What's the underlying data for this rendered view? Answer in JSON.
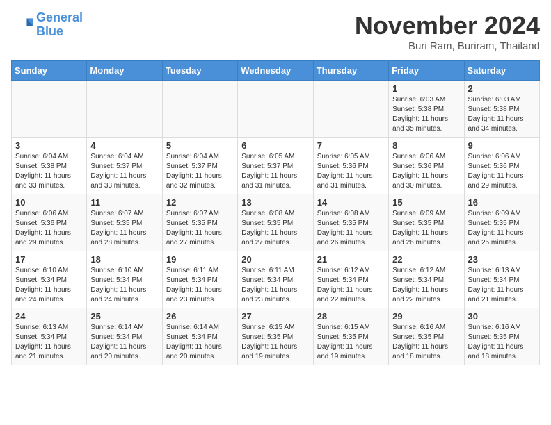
{
  "header": {
    "logo_line1": "General",
    "logo_line2": "Blue",
    "month": "November 2024",
    "location": "Buri Ram, Buriram, Thailand"
  },
  "weekdays": [
    "Sunday",
    "Monday",
    "Tuesday",
    "Wednesday",
    "Thursday",
    "Friday",
    "Saturday"
  ],
  "weeks": [
    [
      {
        "day": "",
        "text": ""
      },
      {
        "day": "",
        "text": ""
      },
      {
        "day": "",
        "text": ""
      },
      {
        "day": "",
        "text": ""
      },
      {
        "day": "",
        "text": ""
      },
      {
        "day": "1",
        "text": "Sunrise: 6:03 AM\nSunset: 5:38 PM\nDaylight: 11 hours\nand 35 minutes."
      },
      {
        "day": "2",
        "text": "Sunrise: 6:03 AM\nSunset: 5:38 PM\nDaylight: 11 hours\nand 34 minutes."
      }
    ],
    [
      {
        "day": "3",
        "text": "Sunrise: 6:04 AM\nSunset: 5:38 PM\nDaylight: 11 hours\nand 33 minutes."
      },
      {
        "day": "4",
        "text": "Sunrise: 6:04 AM\nSunset: 5:37 PM\nDaylight: 11 hours\nand 33 minutes."
      },
      {
        "day": "5",
        "text": "Sunrise: 6:04 AM\nSunset: 5:37 PM\nDaylight: 11 hours\nand 32 minutes."
      },
      {
        "day": "6",
        "text": "Sunrise: 6:05 AM\nSunset: 5:37 PM\nDaylight: 11 hours\nand 31 minutes."
      },
      {
        "day": "7",
        "text": "Sunrise: 6:05 AM\nSunset: 5:36 PM\nDaylight: 11 hours\nand 31 minutes."
      },
      {
        "day": "8",
        "text": "Sunrise: 6:06 AM\nSunset: 5:36 PM\nDaylight: 11 hours\nand 30 minutes."
      },
      {
        "day": "9",
        "text": "Sunrise: 6:06 AM\nSunset: 5:36 PM\nDaylight: 11 hours\nand 29 minutes."
      }
    ],
    [
      {
        "day": "10",
        "text": "Sunrise: 6:06 AM\nSunset: 5:36 PM\nDaylight: 11 hours\nand 29 minutes."
      },
      {
        "day": "11",
        "text": "Sunrise: 6:07 AM\nSunset: 5:35 PM\nDaylight: 11 hours\nand 28 minutes."
      },
      {
        "day": "12",
        "text": "Sunrise: 6:07 AM\nSunset: 5:35 PM\nDaylight: 11 hours\nand 27 minutes."
      },
      {
        "day": "13",
        "text": "Sunrise: 6:08 AM\nSunset: 5:35 PM\nDaylight: 11 hours\nand 27 minutes."
      },
      {
        "day": "14",
        "text": "Sunrise: 6:08 AM\nSunset: 5:35 PM\nDaylight: 11 hours\nand 26 minutes."
      },
      {
        "day": "15",
        "text": "Sunrise: 6:09 AM\nSunset: 5:35 PM\nDaylight: 11 hours\nand 26 minutes."
      },
      {
        "day": "16",
        "text": "Sunrise: 6:09 AM\nSunset: 5:35 PM\nDaylight: 11 hours\nand 25 minutes."
      }
    ],
    [
      {
        "day": "17",
        "text": "Sunrise: 6:10 AM\nSunset: 5:34 PM\nDaylight: 11 hours\nand 24 minutes."
      },
      {
        "day": "18",
        "text": "Sunrise: 6:10 AM\nSunset: 5:34 PM\nDaylight: 11 hours\nand 24 minutes."
      },
      {
        "day": "19",
        "text": "Sunrise: 6:11 AM\nSunset: 5:34 PM\nDaylight: 11 hours\nand 23 minutes."
      },
      {
        "day": "20",
        "text": "Sunrise: 6:11 AM\nSunset: 5:34 PM\nDaylight: 11 hours\nand 23 minutes."
      },
      {
        "day": "21",
        "text": "Sunrise: 6:12 AM\nSunset: 5:34 PM\nDaylight: 11 hours\nand 22 minutes."
      },
      {
        "day": "22",
        "text": "Sunrise: 6:12 AM\nSunset: 5:34 PM\nDaylight: 11 hours\nand 22 minutes."
      },
      {
        "day": "23",
        "text": "Sunrise: 6:13 AM\nSunset: 5:34 PM\nDaylight: 11 hours\nand 21 minutes."
      }
    ],
    [
      {
        "day": "24",
        "text": "Sunrise: 6:13 AM\nSunset: 5:34 PM\nDaylight: 11 hours\nand 21 minutes."
      },
      {
        "day": "25",
        "text": "Sunrise: 6:14 AM\nSunset: 5:34 PM\nDaylight: 11 hours\nand 20 minutes."
      },
      {
        "day": "26",
        "text": "Sunrise: 6:14 AM\nSunset: 5:34 PM\nDaylight: 11 hours\nand 20 minutes."
      },
      {
        "day": "27",
        "text": "Sunrise: 6:15 AM\nSunset: 5:35 PM\nDaylight: 11 hours\nand 19 minutes."
      },
      {
        "day": "28",
        "text": "Sunrise: 6:15 AM\nSunset: 5:35 PM\nDaylight: 11 hours\nand 19 minutes."
      },
      {
        "day": "29",
        "text": "Sunrise: 6:16 AM\nSunset: 5:35 PM\nDaylight: 11 hours\nand 18 minutes."
      },
      {
        "day": "30",
        "text": "Sunrise: 6:16 AM\nSunset: 5:35 PM\nDaylight: 11 hours\nand 18 minutes."
      }
    ]
  ]
}
